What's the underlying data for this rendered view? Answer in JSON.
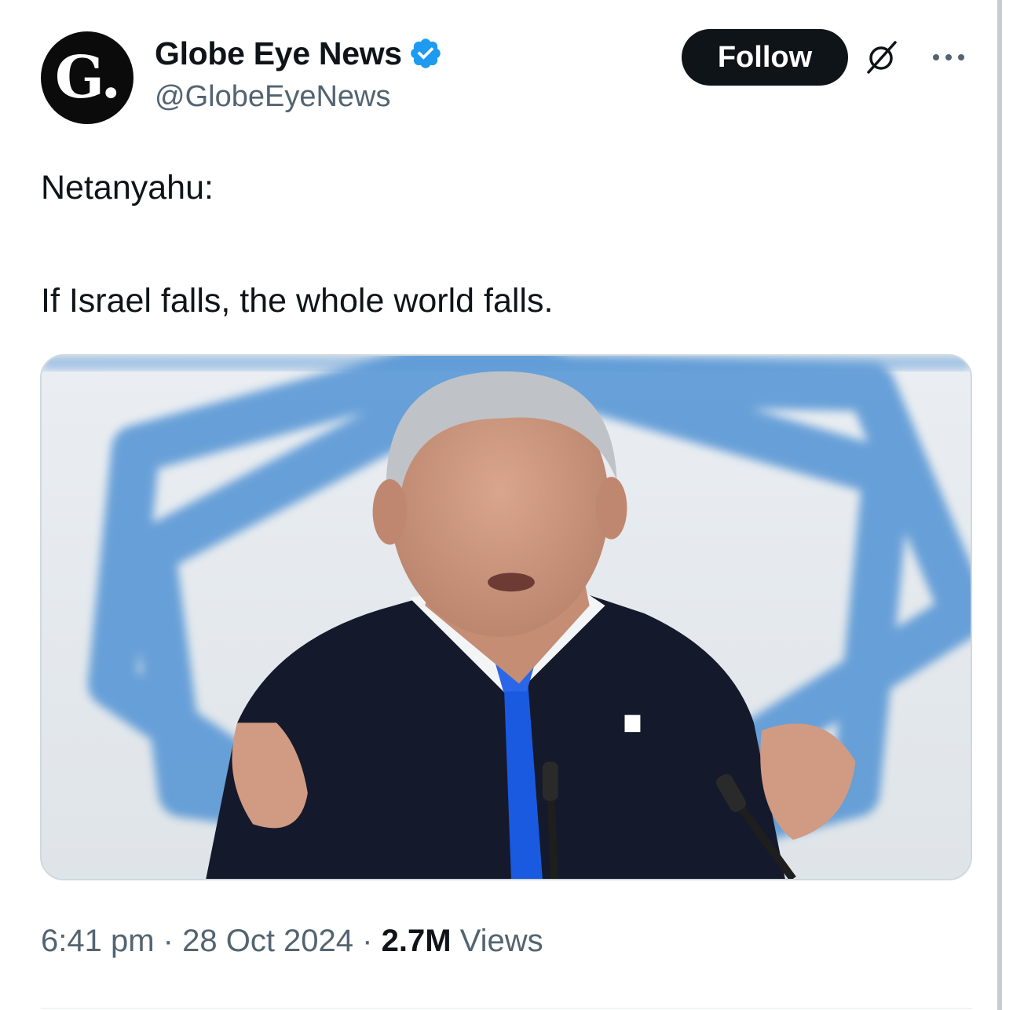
{
  "author": {
    "display_name": "Globe Eye News",
    "handle": "@GlobeEyeNews",
    "avatar_text": "G.",
    "verified": true
  },
  "actions": {
    "follow_label": "Follow",
    "grok_icon": "grok-slash-icon",
    "more_icon": "more-horizontal-icon"
  },
  "tweet": {
    "line1": "Netanyahu:",
    "line2": "If Israel falls, the whole world falls."
  },
  "meta": {
    "time": "6:41 pm",
    "separator": "·",
    "date": "28 Oct 2024",
    "views_count": "2.7M",
    "views_label": "Views"
  },
  "colors": {
    "verified_blue": "#1d9bf0",
    "text_primary": "#0f1419",
    "text_secondary": "#536471",
    "flag_blue": "#4a8fd0",
    "tie_blue": "#1a5ae0"
  }
}
